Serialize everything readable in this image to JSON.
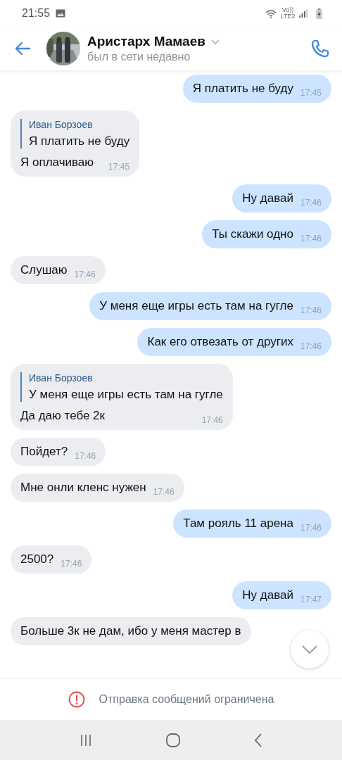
{
  "status_bar": {
    "time": "21:55",
    "network": "Vo)) LTE2"
  },
  "header": {
    "name": "Аристарх Мамаев",
    "status": "был в сети недавно"
  },
  "messages": [
    {
      "kind": "outgoing",
      "text": "Я платить не буду",
      "time": "17:45"
    },
    {
      "kind": "incoming",
      "reply": {
        "author": "Иван Борзоев",
        "text": "Я платить не буду"
      },
      "text": "Я оплачиваю",
      "time": "17:45"
    },
    {
      "kind": "outgoing",
      "text": "Ну давай",
      "time": "17:46"
    },
    {
      "kind": "outgoing",
      "text": "Ты скажи одно",
      "time": "17:46"
    },
    {
      "kind": "incoming",
      "text": "Слушаю",
      "time": "17:46"
    },
    {
      "kind": "outgoing",
      "text": "У меня еще игры есть там на гугле",
      "time": "17:46"
    },
    {
      "kind": "outgoing",
      "text": "Как его отвезать от других",
      "time": "17:46"
    },
    {
      "kind": "incoming",
      "reply": {
        "author": "Иван Борзоев",
        "text": "У меня еще игры есть там на гугле"
      },
      "text": "Да даю тебе 2к",
      "time": "17:46"
    },
    {
      "kind": "incoming",
      "text": "Пойдет?",
      "time": "17:46"
    },
    {
      "kind": "incoming",
      "text": "Мне онли кленс нужен",
      "time": "17:46"
    },
    {
      "kind": "outgoing",
      "text": "Там рояль 11 арена",
      "time": "17:46"
    },
    {
      "kind": "incoming",
      "text": "2500?",
      "time": "17:46"
    },
    {
      "kind": "outgoing",
      "text": "Ну давай",
      "time": "17:47"
    },
    {
      "kind": "incoming",
      "text": "Больше 3к не дам, ибо у меня мастер в"
    }
  ],
  "notice": "Отправка сообщений ограничена"
}
